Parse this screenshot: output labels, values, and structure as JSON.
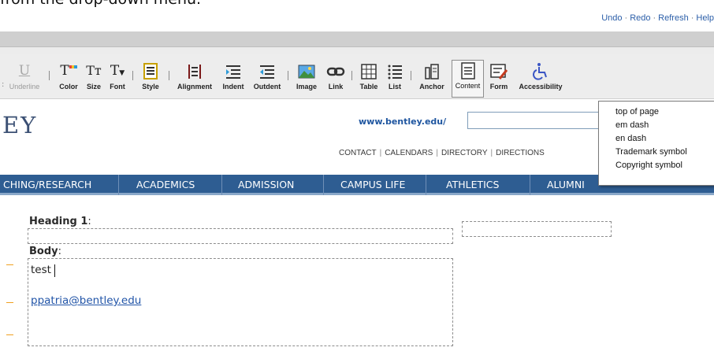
{
  "instruction_text": "from the drop-down menu.",
  "top_links": {
    "undo": "Undo",
    "redo": "Redo",
    "refresh": "Refresh",
    "help": "Help",
    "separator": "·"
  },
  "toolbar": {
    "underline": "Underline",
    "color": "Color",
    "size": "Size",
    "font": "Font",
    "style": "Style",
    "alignment": "Alignment",
    "indent": "Indent",
    "outdent": "Outdent",
    "image": "Image",
    "link": "Link",
    "table": "Table",
    "list": "List",
    "anchor": "Anchor",
    "content": "Content",
    "form": "Form",
    "accessibility": "Accessibility",
    "glyph_u": "U",
    "glyph_t": "T",
    "glyph_tt": "Tт"
  },
  "site": {
    "logo_fragment": "EY",
    "url": "www.bentley.edu/",
    "util_links": [
      "CONTACT",
      "CALENDARS",
      "DIRECTORY",
      "DIRECTIONS"
    ]
  },
  "nav": [
    "CHING/RESEARCH",
    "ACADEMICS",
    "ADMISSION",
    "CAMPUS LIFE",
    "ATHLETICS",
    "ALUMNI"
  ],
  "dropdown": [
    "top of page",
    "em dash",
    "en dash",
    "Trademark symbol",
    "Copyright symbol"
  ],
  "editor": {
    "heading_label": "Heading 1",
    "body_label": "Body",
    "colon": ":",
    "body_text": "test",
    "email": "ppatria@bentley.edu"
  },
  "colors": {
    "nav_bg": "#2e5d92",
    "link": "#2255a8",
    "accent_dash": "#f0a020"
  }
}
